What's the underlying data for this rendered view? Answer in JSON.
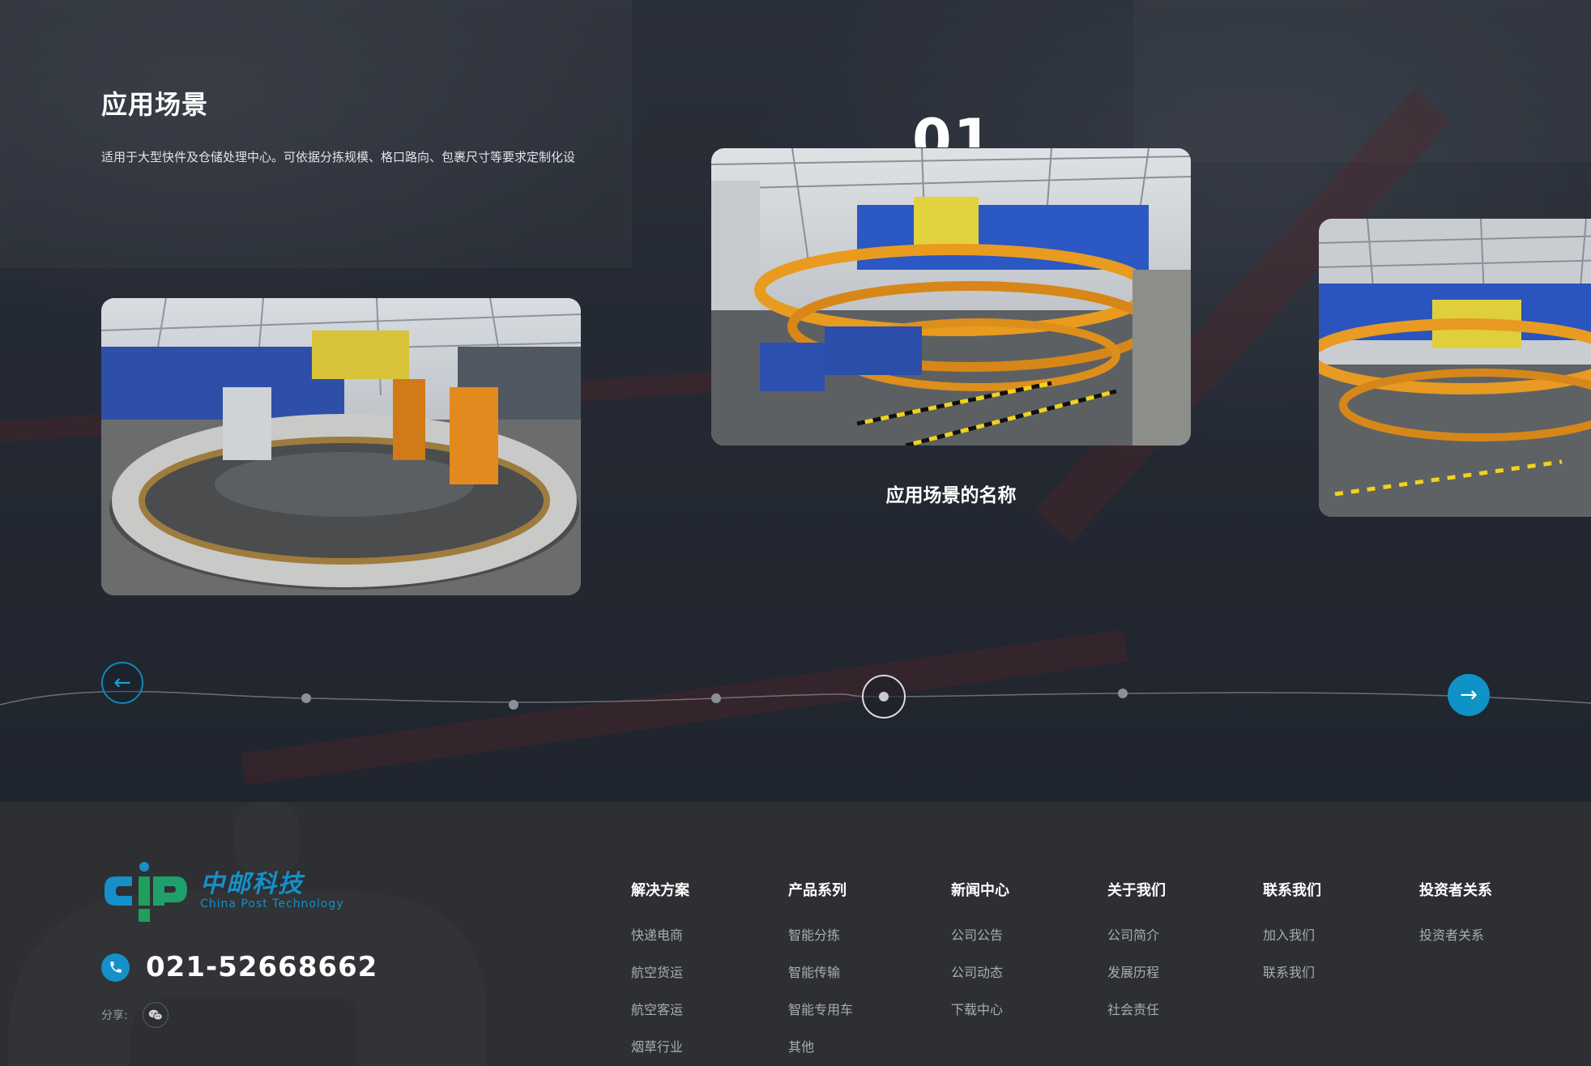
{
  "scenes": {
    "title": "应用场景",
    "description": "适用于大型快件及仓储处理中心。可依据分拣规模、格口路向、包裹尺寸等要求定制化设",
    "current_index": "01",
    "active_caption": "应用场景的名称",
    "prev_arrow": "←",
    "next_arrow": "→"
  },
  "footer": {
    "logo_cn": "中邮科技",
    "logo_en": "China Post Technology",
    "phone": "021-52668662",
    "share_label": "分享:",
    "columns": [
      {
        "heading": "解决方案",
        "links": [
          "快递电商",
          "航空货运",
          "航空客运",
          "烟草行业"
        ]
      },
      {
        "heading": "产品系列",
        "links": [
          "智能分拣",
          "智能传输",
          "智能专用车",
          "其他"
        ]
      },
      {
        "heading": "新闻中心",
        "links": [
          "公司公告",
          "公司动态",
          "下载中心"
        ]
      },
      {
        "heading": "关于我们",
        "links": [
          "公司简介",
          "发展历程",
          "社会责任"
        ]
      },
      {
        "heading": "联系我们",
        "links": [
          "加入我们",
          "联系我们"
        ]
      },
      {
        "heading": "投资者关系",
        "links": [
          "投资者关系"
        ]
      }
    ]
  },
  "colors": {
    "accent": "#1590c8",
    "footer_bg": "#2d2f33"
  },
  "icons": [
    "arrow-left-icon",
    "arrow-right-icon",
    "phone-icon",
    "wechat-icon"
  ]
}
